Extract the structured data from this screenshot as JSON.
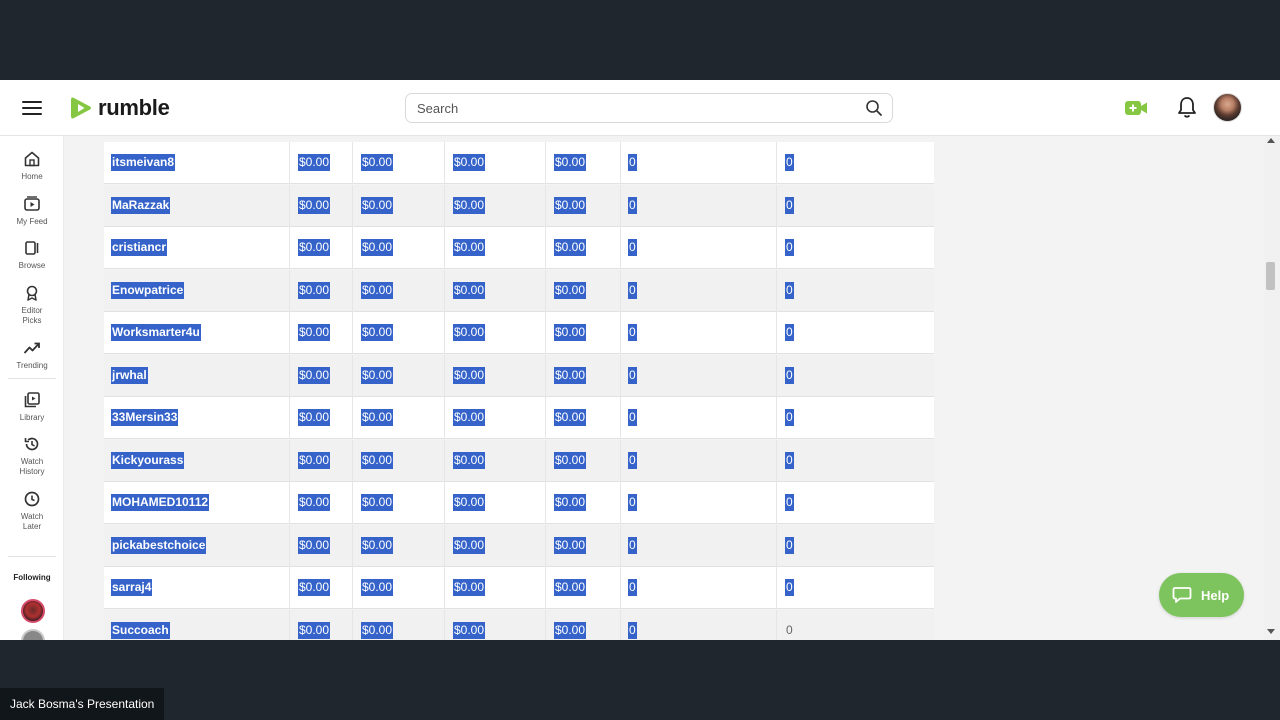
{
  "header": {
    "logo_text": "rumble",
    "search_placeholder": "Search"
  },
  "sidebar": {
    "items": [
      {
        "label": "Home",
        "icon": "home-icon"
      },
      {
        "label": "My Feed",
        "icon": "feed-icon"
      },
      {
        "label": "Browse",
        "icon": "browse-icon"
      },
      {
        "label": "Editor Picks",
        "icon": "award-icon"
      },
      {
        "label": "Trending",
        "icon": "trending-icon"
      },
      {
        "label": "Library",
        "icon": "library-icon"
      },
      {
        "label": "Watch History",
        "icon": "history-icon"
      },
      {
        "label": "Watch Later",
        "icon": "clock-icon"
      }
    ],
    "following_label": "Following"
  },
  "table": {
    "rows": [
      [
        "itsmeivan8",
        "$0.00",
        "$0.00",
        "$0.00",
        "$0.00",
        "0",
        "0"
      ],
      [
        "MaRazzak",
        "$0.00",
        "$0.00",
        "$0.00",
        "$0.00",
        "0",
        "0"
      ],
      [
        "cristiancr",
        "$0.00",
        "$0.00",
        "$0.00",
        "$0.00",
        "0",
        "0"
      ],
      [
        "Enowpatrice",
        "$0.00",
        "$0.00",
        "$0.00",
        "$0.00",
        "0",
        "0"
      ],
      [
        "Worksmarter4u",
        "$0.00",
        "$0.00",
        "$0.00",
        "$0.00",
        "0",
        "0"
      ],
      [
        "jrwhal",
        "$0.00",
        "$0.00",
        "$0.00",
        "$0.00",
        "0",
        "0"
      ],
      [
        "33Mersin33",
        "$0.00",
        "$0.00",
        "$0.00",
        "$0.00",
        "0",
        "0"
      ],
      [
        "Kickyourass",
        "$0.00",
        "$0.00",
        "$0.00",
        "$0.00",
        "0",
        "0"
      ],
      [
        "MOHAMED10112",
        "$0.00",
        "$0.00",
        "$0.00",
        "$0.00",
        "0",
        "0"
      ],
      [
        "pickabestchoice",
        "$0.00",
        "$0.00",
        "$0.00",
        "$0.00",
        "0",
        "0"
      ],
      [
        "sarraj4",
        "$0.00",
        "$0.00",
        "$0.00",
        "$0.00",
        "0",
        "0"
      ],
      [
        "Succoach",
        "$0.00",
        "$0.00",
        "$0.00",
        "$0.00",
        "0",
        "0"
      ]
    ]
  },
  "help_button": {
    "label": "Help"
  },
  "presenter_label": "Jack Bosma's Presentation",
  "colors": {
    "brand_green": "#85c742",
    "selection_blue": "#3563c9",
    "help_green": "#7ec45e"
  }
}
